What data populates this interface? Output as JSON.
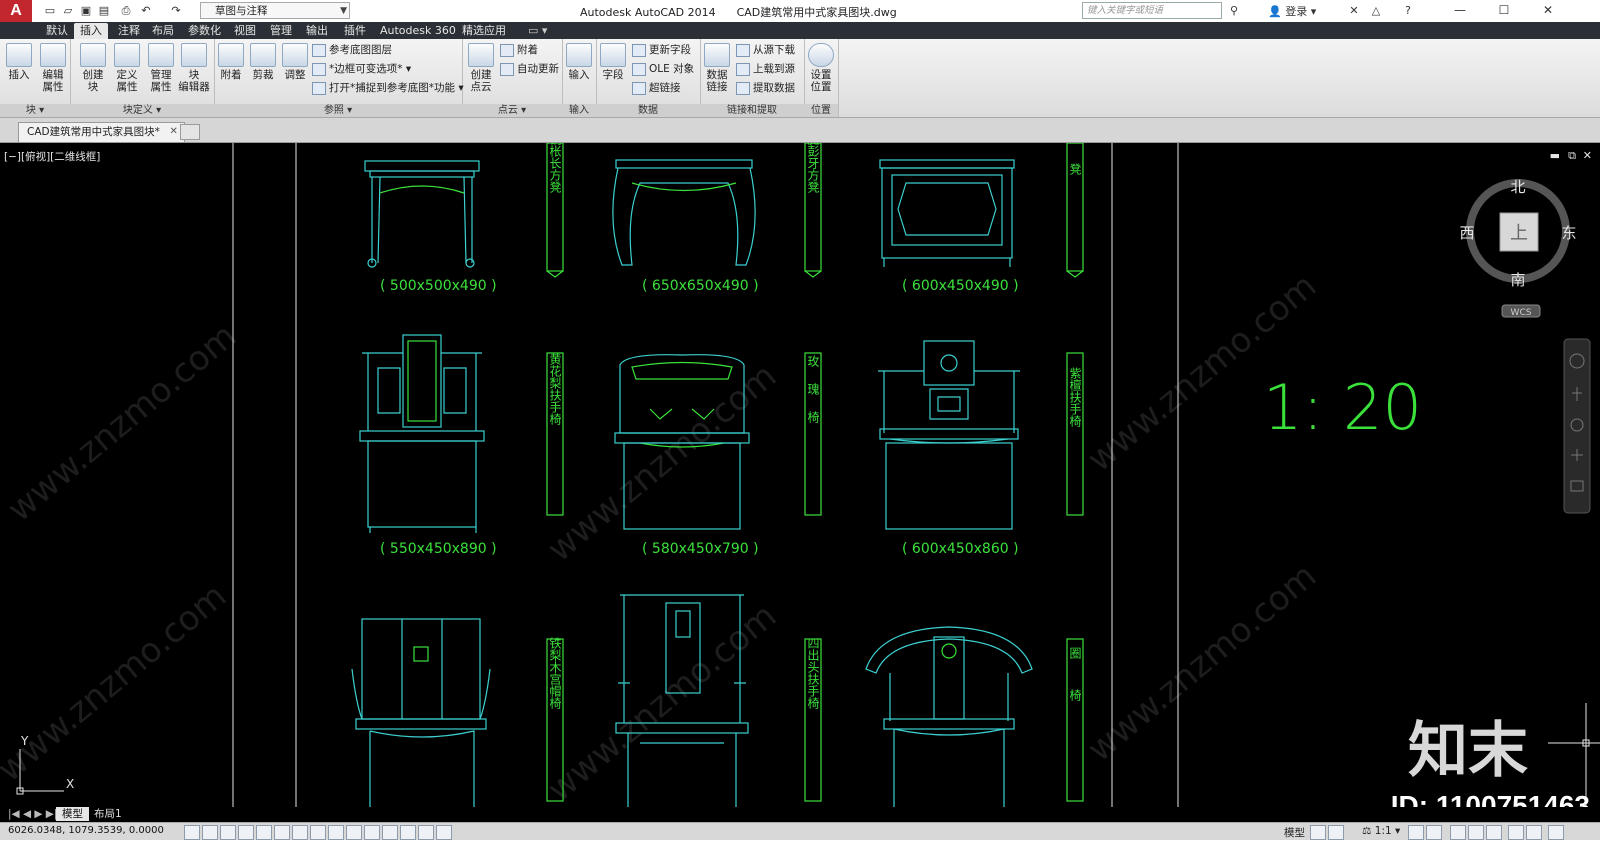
{
  "app": {
    "title": "Autodesk AutoCAD 2014",
    "document": "CAD建筑常用中式家具图块.dwg",
    "logo": "A",
    "workspace": "草图与注释",
    "search_placeholder": "键入关键字或短语",
    "login": "登录"
  },
  "ribbon_tabs": [
    "默认",
    "插入",
    "注释",
    "布局",
    "参数化",
    "视图",
    "管理",
    "输出",
    "插件",
    "Autodesk 360",
    "精选应用"
  ],
  "ribbon": {
    "block": {
      "title": "块",
      "insert": "插入",
      "edit_attr": "编辑\n属性"
    },
    "block_def": {
      "title": "块定义",
      "create": "创建\n块",
      "define_attr": "定义\n属性",
      "manage_attr": "管理\n属性",
      "block_editor": "块\n编辑器"
    },
    "reference": {
      "title": "参照",
      "attach": "附着",
      "clip": "剪裁",
      "adjust": "调整",
      "underlay_layers": "参考底图图层",
      "frame_vary": "*边框可变选项*",
      "snap": "打开*捕捉到参考底图*功能"
    },
    "pointcloud": {
      "title": "点云",
      "create": "创建\n点云",
      "attach": "附着",
      "auto_update": "自动更新"
    },
    "import": {
      "title": "输入",
      "import": "输入"
    },
    "data": {
      "title": "数据",
      "field": "字段",
      "update_fields": "更新字段",
      "ole": "OLE 对象",
      "hyperlink": "超链接"
    },
    "link": {
      "title": "链接和提取",
      "data_link": "数据\n链接",
      "download": "从源下载",
      "upload": "上载到源",
      "extract": "提取数据"
    },
    "location": {
      "title": "位置",
      "set": "设置\n位置"
    }
  },
  "doc_tab": "CAD建筑常用中式家具图块*",
  "viewport_label": "[−][俯视][二维线框]",
  "furniture": [
    {
      "name": "罗锅枨长方凳",
      "size": "( 500x500x490 )"
    },
    {
      "name": "腰鼓腿彭牙方凳",
      "size": "( 650x650x490 )"
    },
    {
      "name": "方凳",
      "size": "( 600x450x490 )"
    },
    {
      "name": "黄花梨扶手椅",
      "size": "( 550x450x890 )"
    },
    {
      "name": "玫瑰椅",
      "size": "( 580x450x790 )"
    },
    {
      "name": "紫檀扶手椅",
      "size": "( 600x450x860 )"
    },
    {
      "name": "铁梨木宫帽椅",
      "size": ""
    },
    {
      "name": "四出头扶手椅",
      "size": ""
    },
    {
      "name": "圈椅",
      "size": ""
    }
  ],
  "scale": "1: 20",
  "viewcube": {
    "north": "北",
    "south": "南",
    "east": "东",
    "west": "西",
    "face": "上",
    "wcs": "WCS"
  },
  "ucs": {
    "x": "X",
    "y": "Y"
  },
  "layout_tabs": [
    "模型",
    "布局1"
  ],
  "status": {
    "coords": "6026.0348, 1079.3539, 0.0000",
    "model": "模型",
    "scale": "1:1"
  },
  "watermark": {
    "logo": "知末",
    "id": "ID: 1100751463",
    "site": "www.znzmo.com"
  },
  "colors": {
    "cyan": "#3cd0d0",
    "green": "#3be13b",
    "ribbon_dark": "#2b3036"
  }
}
